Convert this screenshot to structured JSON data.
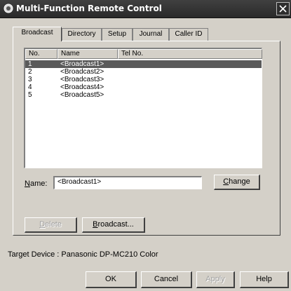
{
  "window": {
    "title": "Multi-Function Remote Control"
  },
  "tabs": [
    {
      "label": "Broadcast",
      "active": true
    },
    {
      "label": "Directory",
      "active": false
    },
    {
      "label": "Setup",
      "active": false
    },
    {
      "label": "Journal",
      "active": false
    },
    {
      "label": "Caller ID",
      "active": false
    }
  ],
  "list": {
    "columns": [
      "No.",
      "Name",
      "Tel No."
    ],
    "rows": [
      {
        "no": "1",
        "name": "<Broadcast1>",
        "tel": "",
        "selected": true
      },
      {
        "no": "2",
        "name": "<Broadcast2>",
        "tel": "",
        "selected": false
      },
      {
        "no": "3",
        "name": "<Broadcast3>",
        "tel": "",
        "selected": false
      },
      {
        "no": "4",
        "name": "<Broadcast4>",
        "tel": "",
        "selected": false
      },
      {
        "no": "5",
        "name": "<Broadcast5>",
        "tel": "",
        "selected": false
      }
    ]
  },
  "name_field": {
    "label_first": "N",
    "label_rest": "ame:",
    "value": "<Broadcast1>"
  },
  "buttons": {
    "change": {
      "first": "C",
      "rest": "hange"
    },
    "delete": {
      "first": "D",
      "rest": "elete"
    },
    "broadcast": {
      "first": "B",
      "rest": "roadcast..."
    },
    "ok": "OK",
    "cancel": "Cancel",
    "apply": "Apply",
    "help": "Help"
  },
  "target_device": "Target Device : Panasonic DP-MC210 Color",
  "icons": {
    "app": "remote-control-icon",
    "close": "close-icon"
  },
  "colors": {
    "titlebar": "#2a2a2a",
    "face": "#d4d0c8",
    "selection": "#5a5a5a"
  }
}
